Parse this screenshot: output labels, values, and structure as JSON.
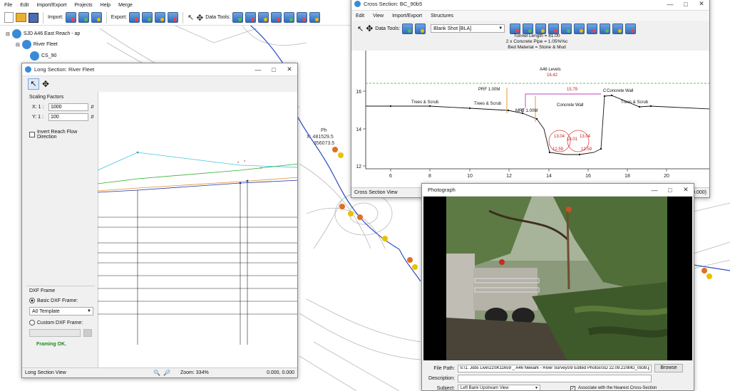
{
  "main": {
    "menu": [
      "File",
      "Edit",
      "Import/Export",
      "Projects",
      "Help",
      "Merge"
    ],
    "import_label": "Import:",
    "export_label": "Export:",
    "data_tools_label": "Data Tools:"
  },
  "tree": {
    "root": "SJD A46 East Reach - ap",
    "child": "River Fleet",
    "leaf": "CS_90"
  },
  "map_labels": {
    "ph_label": "Ph",
    "coord_x": "X: 481529.5",
    "coord_y": "356073.5"
  },
  "long_section": {
    "title": "Long Section: River Fleet",
    "scaling_label": "Scaling Factors",
    "x_label": "X: 1 :",
    "x_value": "1000",
    "y_label": "Y: 1 :",
    "y_value": "100",
    "invert_label": "Invert Reach Flow Direction",
    "dxf_frame_label": "DXF Frame",
    "basic_label": "Basic DXF Frame:",
    "basic_value": "A0 Template",
    "custom_label": "Custom DXF Frame:",
    "framing_ok": "Framing OK.",
    "status": "Long Section View",
    "zoom": "Zoom: 334%",
    "coords": "0.000, 0.000"
  },
  "cross_section": {
    "title": "Cross Section: BC_90b5",
    "menu": [
      "Edit",
      "View",
      "Import/Export",
      "Structures"
    ],
    "data_tools_label": "Data Tools:",
    "shot_value": "Blank Shot [BLA]",
    "status": "Cross Section View",
    "coords": "0.000)",
    "header_line1": "Tunnel Length = 81.00",
    "header_line2": "2 x Concrete Pipe = 1.05%%c",
    "header_line3": "Bed Material = Stone & Mud",
    "labels": {
      "a46": "A46 Levels",
      "a46_val": "16.42",
      "prf": "PRF 1.00M",
      "mrf": "MRF 1.00M",
      "c1": "C",
      "c2": "C",
      "val_1579": "15.79",
      "concrete_wall": "Concrete Wall",
      "concrete_wall2": "Concrete Wall",
      "trees1": "Trees & Scrub",
      "trees2": "Trees & Scrub",
      "trees3": "Trees & Scrub",
      "d1": "13.04",
      "d2": "13.04",
      "d3": "13.01",
      "d4": "12.59",
      "d5": "12.59"
    },
    "x_ticks": [
      "6",
      "8",
      "10",
      "12",
      "14",
      "16",
      "18",
      "20"
    ],
    "y_ticks": [
      "16",
      "14",
      "12"
    ]
  },
  "photograph": {
    "title": "Photograph",
    "file_path_label": "File Path:",
    "file_path_value": "S:\\1. Jobs Live\\22SK11659 _ A46 Newark - River Surveys\\9 Edited Photos\\SD 22.09.22\\IMG_0839.jpg",
    "browse_label": "Browse",
    "description_label": "Description:",
    "description_value": "",
    "subject_label": "Subject:",
    "subject_value": "Left Bank Upstream View",
    "associate_label": "Associate with the Nearest Cross-Section"
  }
}
